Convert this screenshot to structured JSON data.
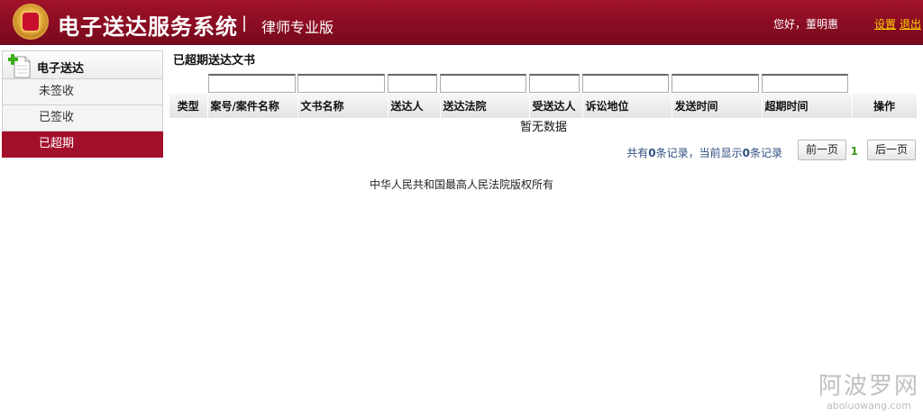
{
  "header": {
    "title": "电子送达服务系统",
    "separator": "|",
    "edition": "律师专业版",
    "greeting": "您好，董明惠",
    "settings_label": "设置",
    "logout_label": "退出",
    "brand_color": "#8a0c22",
    "link_color": "#ffd200"
  },
  "sidebar": {
    "section_label": "电子送达",
    "items": [
      {
        "label": "未签收",
        "active": false
      },
      {
        "label": "已签收",
        "active": false
      },
      {
        "label": "已超期",
        "active": true
      }
    ],
    "active_color": "#a3102b"
  },
  "main": {
    "page_title": "已超期送达文书",
    "columns": [
      "类型",
      "案号/案件名称",
      "文书名称",
      "送达人",
      "送达法院",
      "受送达人",
      "诉讼地位",
      "发送时间",
      "超期时间",
      "操作"
    ],
    "empty_text": "暂无数据",
    "pager": {
      "summary": [
        "共有",
        "0",
        "条记录，当前显示",
        "0",
        "条记录"
      ],
      "prev_label": "前一页",
      "current_page": "1",
      "next_label": "后一页"
    }
  },
  "footer": {
    "copyright": "中华人民共和国最高人民法院版权所有"
  },
  "watermark": {
    "title": "阿波罗网",
    "url": "aboluowang.com"
  }
}
